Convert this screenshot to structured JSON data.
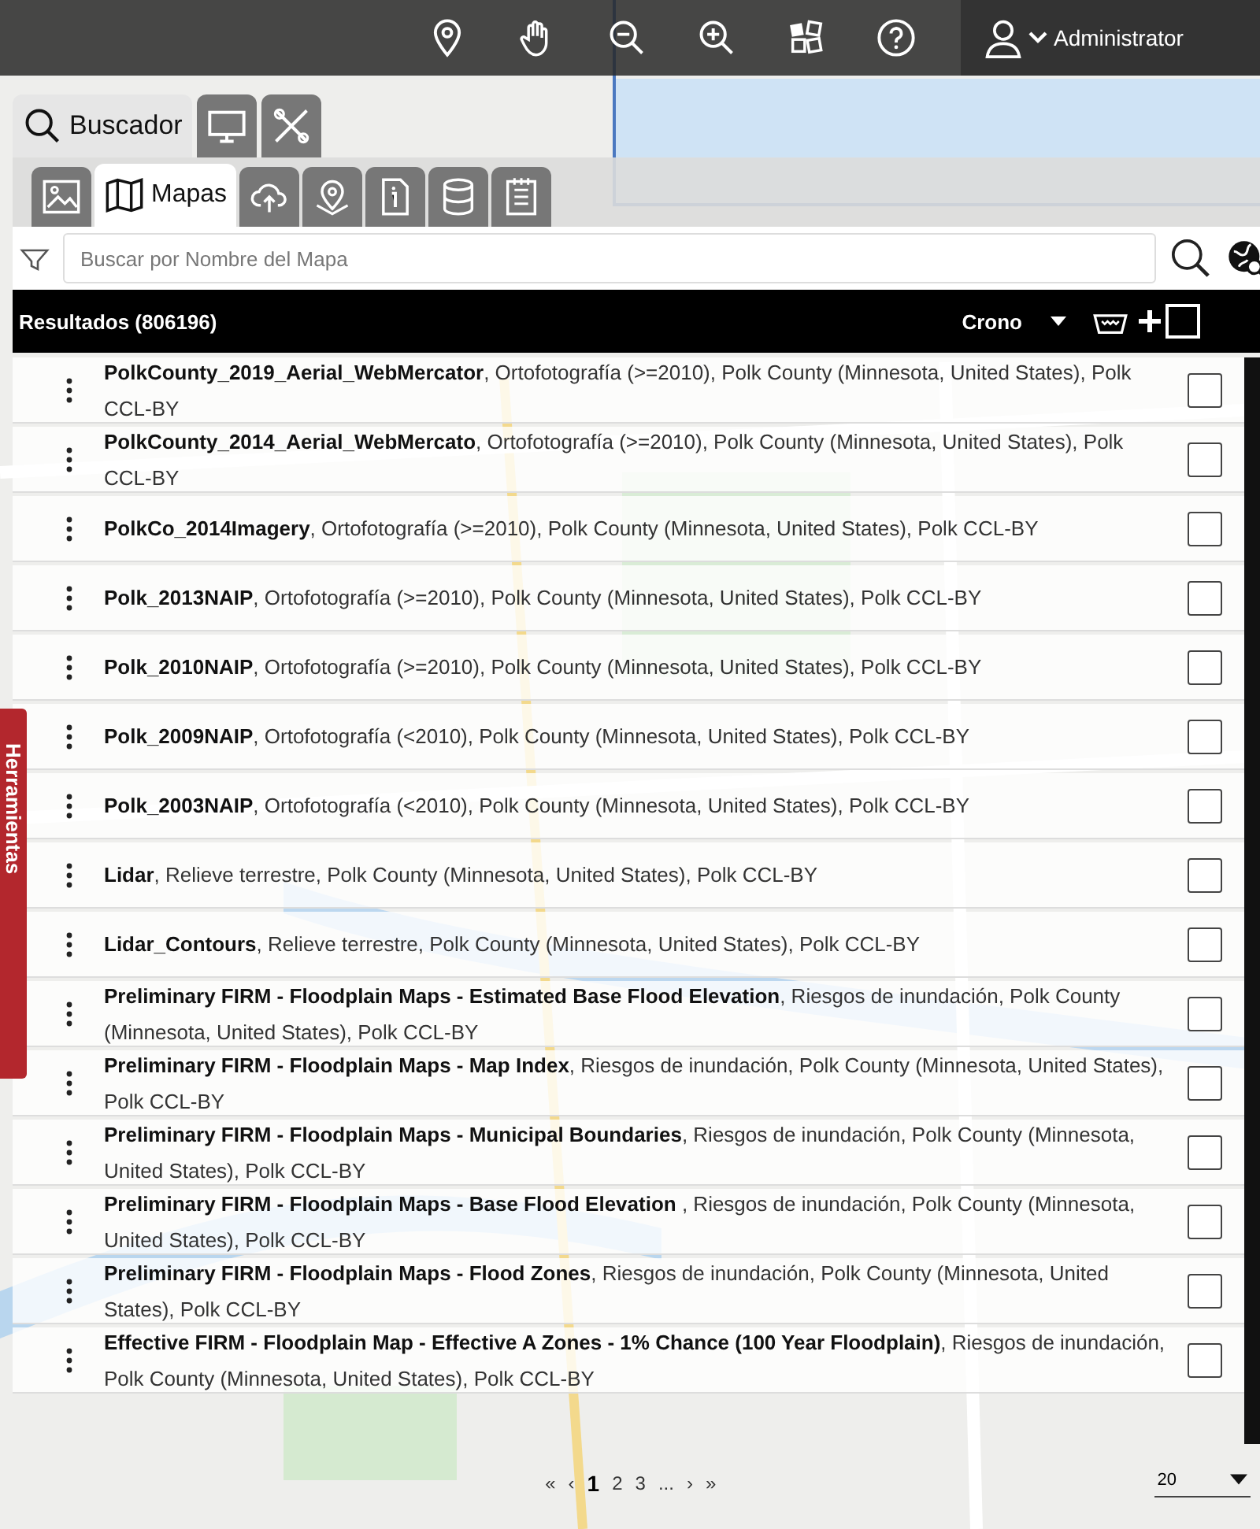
{
  "toolbar": {
    "user": "Administrator"
  },
  "side_tab": {
    "label": "Herramientas"
  },
  "main_tabs": [
    {
      "label": "Buscador",
      "selected": true
    },
    {
      "selected": false
    },
    {
      "selected": false
    }
  ],
  "sub_tabs": [
    {
      "selected": false
    },
    {
      "label": "Mapas",
      "selected": true
    },
    {
      "selected": false
    },
    {
      "selected": false
    },
    {
      "selected": false
    },
    {
      "selected": false
    },
    {
      "selected": false
    }
  ],
  "search": {
    "placeholder": "Buscar por Nombre del Mapa"
  },
  "results": {
    "title": "Resultados (806196)",
    "sort": "Crono",
    "all_checked": false
  },
  "rows": [
    {
      "name": "PolkCounty_2019_Aerial_WebMercator",
      "details": ", Ortofotografía (>=2010), Polk County (Minnesota, United States), Polk CCL-BY",
      "checked": false
    },
    {
      "name": "PolkCounty_2014_Aerial_WebMercato",
      "details": ", Ortofotografía (>=2010), Polk County (Minnesota, United States), Polk CCL-BY",
      "checked": false
    },
    {
      "name": "PolkCo_2014Imagery",
      "details": ", Ortofotografía (>=2010), Polk County (Minnesota, United States), Polk CCL-BY",
      "checked": false
    },
    {
      "name": "Polk_2013NAIP",
      "details": ", Ortofotografía (>=2010), Polk County (Minnesota, United States), Polk CCL-BY",
      "checked": false
    },
    {
      "name": "Polk_2010NAIP",
      "details": ", Ortofotografía (>=2010), Polk County (Minnesota, United States), Polk CCL-BY",
      "checked": false
    },
    {
      "name": "Polk_2009NAIP",
      "details": ", Ortofotografía (<2010), Polk County (Minnesota, United States), Polk CCL-BY",
      "checked": false
    },
    {
      "name": "Polk_2003NAIP",
      "details": ", Ortofotografía (<2010), Polk County (Minnesota, United States), Polk CCL-BY",
      "checked": false
    },
    {
      "name": "Lidar",
      "details": ", Relieve terrestre, Polk County (Minnesota, United States), Polk CCL-BY",
      "checked": false
    },
    {
      "name": "Lidar_Contours",
      "details": ", Relieve terrestre, Polk County (Minnesota, United States), Polk CCL-BY",
      "checked": false
    },
    {
      "name": "Preliminary FIRM - Floodplain Maps - Estimated Base Flood Elevation",
      "details": ", Riesgos de inundación, Polk County (Minnesota, United States), Polk CCL-BY",
      "checked": false
    },
    {
      "name": "Preliminary FIRM - Floodplain Maps - Map Index",
      "details": ", Riesgos de inundación, Polk County (Minnesota, United States), Polk CCL-BY",
      "checked": false
    },
    {
      "name": "Preliminary FIRM - Floodplain Maps - Municipal Boundaries",
      "details": ", Riesgos de inundación, Polk County (Minnesota, United States), Polk CCL-BY",
      "checked": false
    },
    {
      "name": "Preliminary FIRM - Floodplain Maps - Base Flood Elevation ",
      "details": ", Riesgos de inundación, Polk County (Minnesota, United States), Polk CCL-BY",
      "checked": false
    },
    {
      "name": "Preliminary FIRM - Floodplain Maps - Flood Zones",
      "details": ", Riesgos de inundación, Polk County (Minnesota, United States), Polk CCL-BY",
      "checked": false
    },
    {
      "name": "Effective FIRM - Floodplain Map - Effective A Zones - 1% Chance (100 Year Floodplain)",
      "details": ", Riesgos de inundación, Polk County (Minnesota, United States), Polk CCL-BY",
      "checked": false
    }
  ],
  "pagination": {
    "first": "«",
    "prev": "‹",
    "pages": [
      {
        "label": "1",
        "selected": true
      },
      {
        "label": "2",
        "selected": false
      },
      {
        "label": "3",
        "selected": false
      }
    ],
    "ellipsis": "...",
    "next": "›",
    "last": "»"
  },
  "page_size": "20"
}
